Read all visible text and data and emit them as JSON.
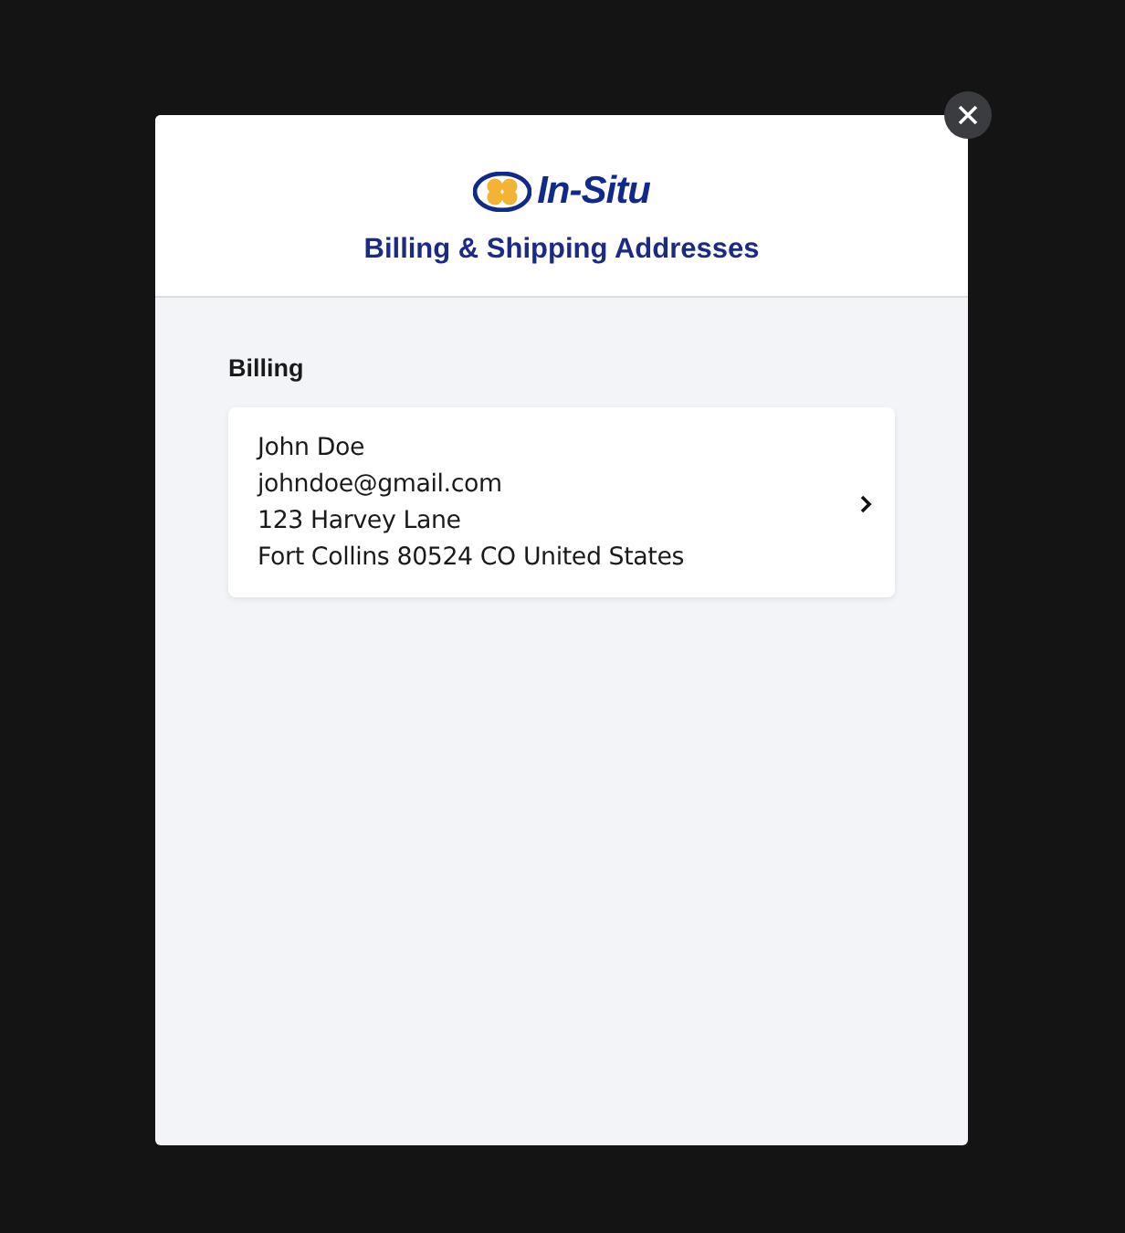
{
  "dialog": {
    "logo_text": "In-Situ",
    "title": "Billing & Shipping Addresses"
  },
  "section": {
    "heading": "Billing",
    "address": {
      "lines": [
        "John Doe",
        "johndoe@gmail.com",
        "123 Harvey Lane",
        "Fort Collins 80524 CO United States"
      ]
    }
  }
}
